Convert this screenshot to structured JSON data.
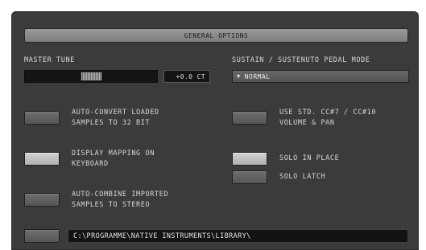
{
  "header": {
    "title": "GENERAL OPTIONS"
  },
  "master_tune": {
    "label": "MASTER TUNE",
    "value": "+0.0 CT",
    "slider_position": 0.5
  },
  "pedal_mode": {
    "label": "SUSTAIN / SUSTENUTO PEDAL MODE",
    "selected": "NORMAL"
  },
  "options": {
    "auto_convert": {
      "line1": "AUTO-CONVERT LOADED",
      "line2": "SAMPLES TO 32 BIT",
      "checked": false
    },
    "display_mapping": {
      "line1": "DISPLAY MAPPING ON",
      "line2": "KEYBOARD",
      "checked": true
    },
    "auto_combine": {
      "line1": "AUTO-COMBINE IMPORTED",
      "line2": "SAMPLES TO STEREO",
      "checked": false
    },
    "use_std_cc": {
      "line1": "USE STD. CC#7 / CC#10",
      "line2": "VOLUME & PAN",
      "checked": false
    },
    "solo_in_place": {
      "label": "SOLO IN PLACE",
      "checked": true
    },
    "solo_latch": {
      "label": "SOLO LATCH",
      "checked": false
    }
  },
  "library_path": {
    "checked": false,
    "value": "C:\\PROGRAMME\\NATIVE INSTRUMENTS\\LIBRARY\\"
  },
  "colors": {
    "panel": "#3b3b3b",
    "text": "#d8d8d8",
    "toggle_on": "#c4c4c4",
    "toggle_off": "#626262"
  }
}
